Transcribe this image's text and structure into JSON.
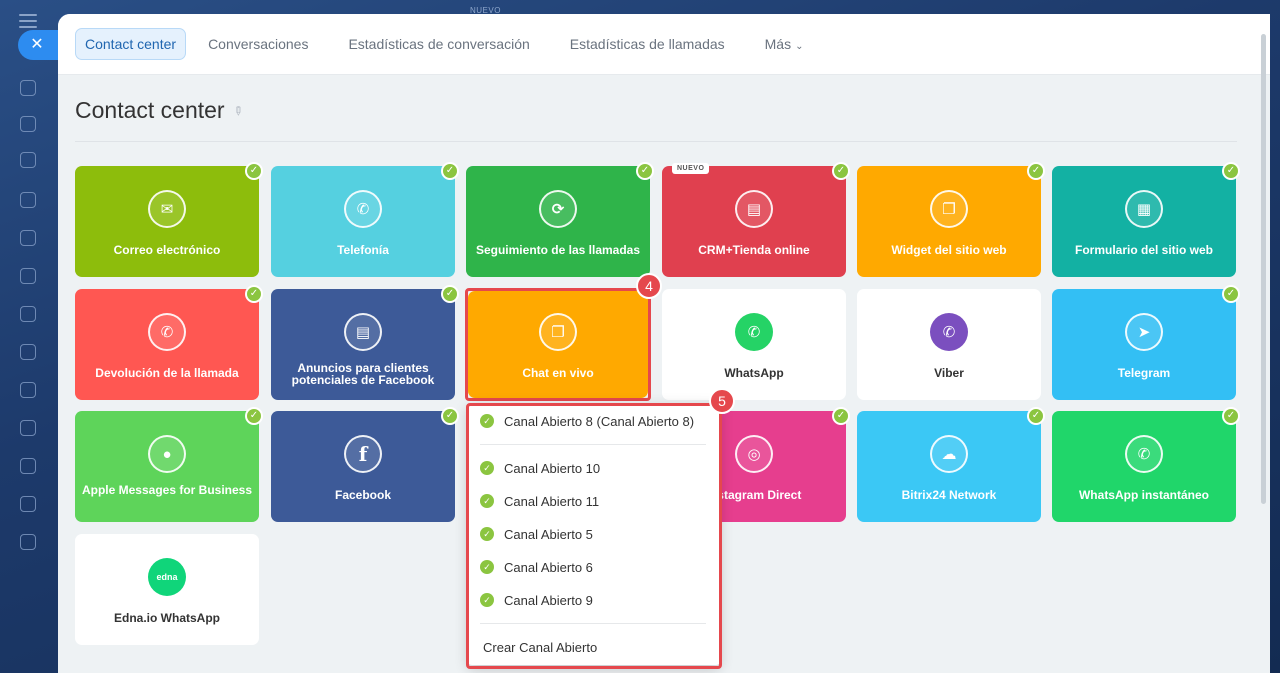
{
  "top_strip": "NUEVO",
  "tabs": [
    {
      "label": "Contact center"
    },
    {
      "label": "Conversaciones"
    },
    {
      "label": "Estadísticas de conversación"
    },
    {
      "label": "Estadísticas de llamadas"
    },
    {
      "label": "Más"
    }
  ],
  "page_title": "Contact center",
  "tiles": {
    "email": "Correo electrónico",
    "telephony": "Telefonía",
    "call_tracking": "Seguimiento de las llamadas",
    "crm_store": "CRM+Tienda online",
    "crm_store_badge": "NUEVO",
    "site_widget": "Widget del sitio web",
    "site_form": "Formulario del sitio web",
    "callback": "Devolución de la llamada",
    "fb_leads": "Anuncios para clientes potenciales de Facebook",
    "live_chat": "Chat en vivo",
    "whatsapp": "WhatsApp",
    "viber": "Viber",
    "telegram": "Telegram",
    "apple_messages": "Apple Messages for Business",
    "facebook": "Facebook",
    "instagram": "Instagram Direct",
    "bitrix_network": "Bitrix24 Network",
    "whatsapp_instant": "WhatsApp instantáneo",
    "edna": "Edna.io WhatsApp",
    "edna_logo_text": "edna",
    "facebook_glyph": "f"
  },
  "steps": {
    "four": "4",
    "five": "5"
  },
  "dropdown": {
    "items": [
      "Canal Abierto 8 (Canal Abierto 8)",
      "Canal Abierto 10",
      "Canal Abierto 11",
      "Canal Abierto 5",
      "Canal Abierto 6",
      "Canal Abierto 9"
    ],
    "create": "Crear Canal Abierto"
  },
  "colors": {
    "email": "#8dbd0c",
    "telephony": "#55d0e0",
    "call_tracking": "#2fb44a",
    "crm_store": "#e0404f",
    "site_widget": "#ffa900",
    "site_form": "#13b1a3",
    "callback": "#ff5752",
    "fb_leads": "#3d5a98",
    "live_chat": "#ffa900",
    "telegram": "#33bff4",
    "apple_messages": "#5ed45a",
    "instagram": "#e63e8e",
    "bitrix_network": "#3bc8f5",
    "whatsapp_instant": "#20d66a",
    "check": "#8bc540",
    "highlight": "#e5484d"
  }
}
